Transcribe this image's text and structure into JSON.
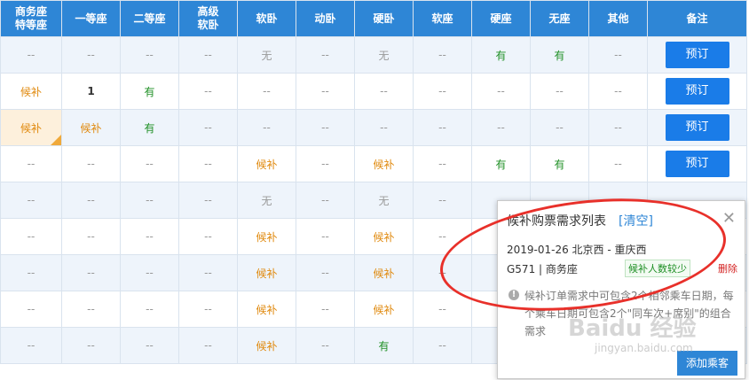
{
  "header": [
    "商务座\n特等座",
    "一等座",
    "二等座",
    "高级\n软卧",
    "软卧",
    "动卧",
    "硬卧",
    "软座",
    "硬座",
    "无座",
    "其他",
    "备注"
  ],
  "rows": [
    {
      "cells": [
        "--",
        "--",
        "--",
        "--",
        "无",
        "--",
        "无",
        "--",
        "有",
        "有",
        "--"
      ],
      "action": "预订"
    },
    {
      "cells": [
        "候补",
        "1",
        "有",
        "--",
        "--",
        "--",
        "--",
        "--",
        "--",
        "--",
        "--"
      ],
      "action": "预订"
    },
    {
      "cells": [
        "候补",
        "候补",
        "有",
        "--",
        "--",
        "--",
        "--",
        "--",
        "--",
        "--",
        "--"
      ],
      "action": "预订"
    },
    {
      "cells": [
        "--",
        "--",
        "--",
        "--",
        "候补",
        "--",
        "候补",
        "--",
        "有",
        "有",
        "--"
      ],
      "action": "预订"
    },
    {
      "cells": [
        "--",
        "--",
        "--",
        "--",
        "无",
        "--",
        "无",
        "--",
        "",
        "",
        ""
      ],
      "action": ""
    },
    {
      "cells": [
        "--",
        "--",
        "--",
        "--",
        "候补",
        "--",
        "候补",
        "--",
        "",
        "",
        ""
      ],
      "action": ""
    },
    {
      "cells": [
        "--",
        "--",
        "--",
        "--",
        "候补",
        "--",
        "候补",
        "--",
        "",
        "",
        ""
      ],
      "action": ""
    },
    {
      "cells": [
        "--",
        "--",
        "--",
        "--",
        "候补",
        "--",
        "候补",
        "--",
        "",
        "",
        ""
      ],
      "action": ""
    },
    {
      "cells": [
        "--",
        "--",
        "--",
        "--",
        "候补",
        "--",
        "有",
        "--",
        "",
        "",
        ""
      ],
      "action": ""
    }
  ],
  "popup": {
    "title": "候补购票需求列表",
    "clear_label": "[清空]",
    "close_icon": "close-icon",
    "route": "2019-01-26 北京西 - 重庆西",
    "train": "G571 | 商务座",
    "status_tag": "候补人数较少",
    "delete_label": "删除",
    "note": "候补订单需求中可包含2个相邻乘车日期，每个乘车日期可包含2个\"同车次+席别\"的组合需求",
    "add_button": "添加乘客"
  },
  "watermark": {
    "brand": "Baidu 经验",
    "url": "jingyan.baidu.com"
  },
  "colors": {
    "header_bg": "#2e86d6",
    "button_bg": "#1a7ce8",
    "orange": "#e0890d",
    "green": "#1e8f24",
    "annotation": "#e8302a"
  }
}
